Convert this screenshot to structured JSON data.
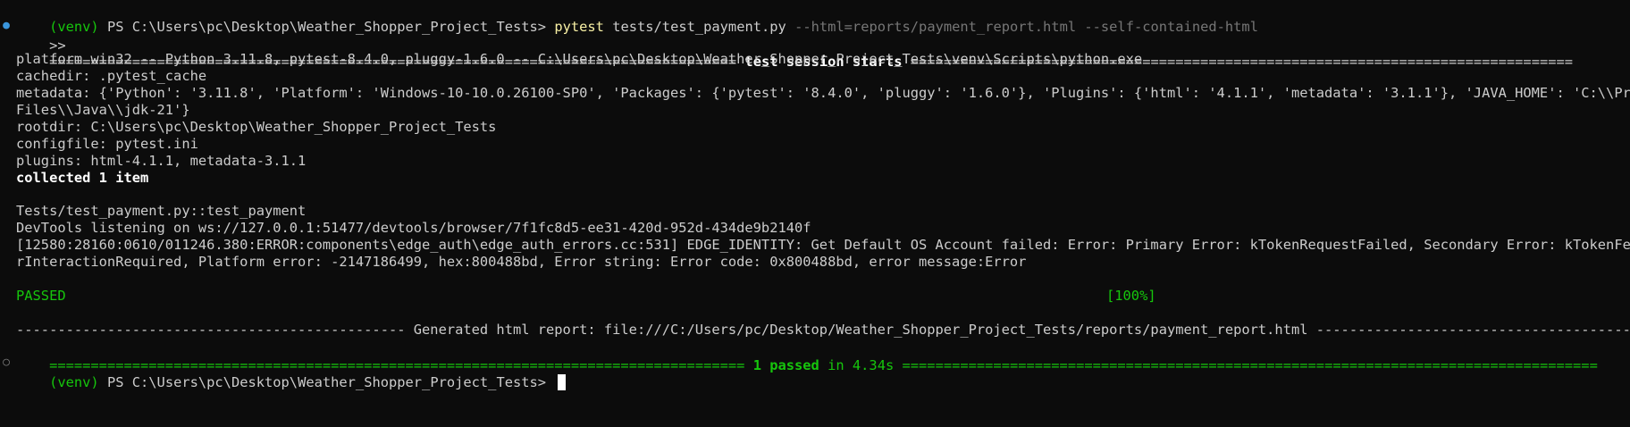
{
  "prompt1": {
    "venv": "(venv)",
    "ps": " PS C:\\Users\\pc\\Desktop\\Weather_Shopper_Project_Tests> ",
    "cmd": "pytest",
    "args": " tests/test_payment.py ",
    "flags": "--html=reports/payment_report.html --self-contained-html"
  },
  "continuation": ">>",
  "session_header": {
    "left": "=================================================================================== ",
    "title": "test session starts",
    "right": " ================================================================================"
  },
  "lines": {
    "platform": "platform win32 -- Python 3.11.8, pytest-8.4.0, pluggy-1.6.0 -- C:\\Users\\pc\\Desktop\\Weather_Shopper_Project_Tests\\venv\\Scripts\\python.exe",
    "cachedir": "cachedir: .pytest_cache",
    "metadata1": "metadata: {'Python': '3.11.8', 'Platform': 'Windows-10-10.0.26100-SP0', 'Packages': {'pytest': '8.4.0', 'pluggy': '1.6.0'}, 'Plugins': {'html': '4.1.1', 'metadata': '3.1.1'}, 'JAVA_HOME': 'C:\\\\Program",
    "metadata2": "Files\\\\Java\\\\jdk-21'}",
    "rootdir": "rootdir: C:\\Users\\pc\\Desktop\\Weather_Shopper_Project_Tests",
    "configfile": "configfile: pytest.ini",
    "plugins": "plugins: html-4.1.1, metadata-3.1.1",
    "collected": "collected 1 item",
    "test_id": "Tests/test_payment.py::test_payment",
    "devtools": "DevTools listening on ws://127.0.0.1:51477/devtools/browser/7f1fc8d5-ee31-420d-952d-434de9b2140f",
    "error1": "[12580:28160:0610/011246.380:ERROR:components\\edge_auth\\edge_auth_errors.cc:531] EDGE_IDENTITY: Get Default OS Account failed: Error: Primary Error: kTokenRequestFailed, Secondary Error: kTokenFetchUse",
    "error2": "rInteractionRequired, Platform error: -2147186499, hex:800488bd, Error string: Error code: 0x800488bd, error message:Error",
    "passed": "PASSED",
    "percent": "[100%]"
  },
  "report_line": "----------------------------------------------- Generated html report: file:///C:/Users/pc/Desktop/Weather_Shopper_Project_Tests/reports/payment_report.html -----------------------------------------------",
  "summary": {
    "left": "==================================================================================== ",
    "passed": "1 passed",
    "time": " in 4.34s",
    "right": " ===================================================================================="
  },
  "prompt2": {
    "venv": "(venv)",
    "ps": " PS C:\\Users\\pc\\Desktop\\Weather_Shopper_Project_Tests> "
  },
  "colors": {
    "background": "#0c0c0c",
    "text": "#cccccc",
    "green": "#16c60c",
    "yellow": "#f9f1a5",
    "dim": "#767676",
    "decoration_blue": "#3a96dd"
  },
  "icons": {
    "gutter_active": "filled-circle",
    "gutter_idle": "hollow-circle"
  }
}
